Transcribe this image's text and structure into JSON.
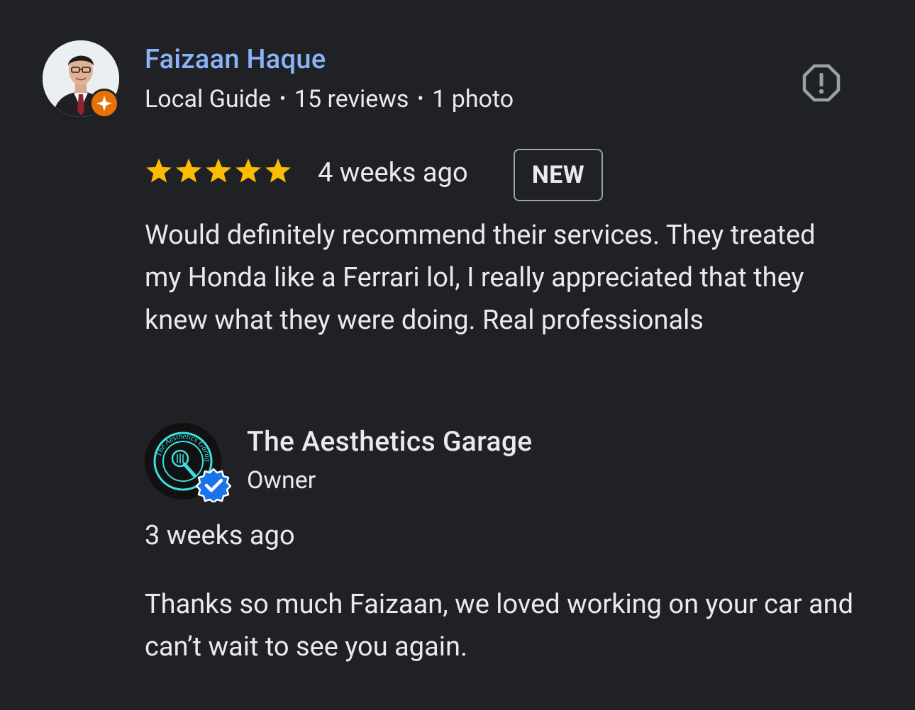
{
  "review": {
    "reviewer_name": "Faizaan Haque",
    "reviewer_level": "Local Guide",
    "reviewer_reviews": "15 reviews",
    "reviewer_photos": "1 photo",
    "separator": "•",
    "rating": 5,
    "max_rating": 5,
    "time": "4 weeks ago",
    "new_badge": "NEW",
    "text": "Would definitely recommend their services. They treated my Honda like a Ferrari lol, I really appreciated that they knew what they were doing. Real professionals",
    "flag_icon": "report-flag-icon"
  },
  "reply": {
    "owner_name": "The Aesthetics Garage",
    "owner_role": "Owner",
    "time": "3 weeks ago",
    "text": "Thanks so much Faizaan, we loved working on your car and can’t wait to see you again.",
    "logo_text": "The Aesthetics Garage"
  },
  "colors": {
    "background": "#202124",
    "reviewer_name": "#8ab4f8",
    "text": "#e8eaed",
    "star": "#fbbc04",
    "local_guide_badge": "#e8710a",
    "verified_badge": "#1a73e8",
    "logo_accent": "#3de0e0"
  }
}
